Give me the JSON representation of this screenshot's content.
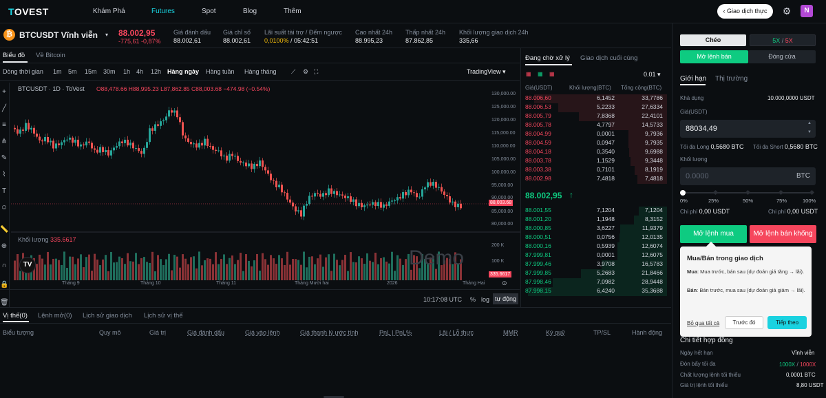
{
  "nav": {
    "logo_t": "T",
    "logo_rest": "OVEST",
    "items": [
      "Khám Phá",
      "Futures",
      "Spot",
      "Blog",
      "Thêm"
    ],
    "trade_button": "Giao dịch thực",
    "avatar": "N"
  },
  "ticker": {
    "symbol": "BTCUSDT Vĩnh viễn",
    "price": "88.002,95",
    "change": "-775,61",
    "change_pct": "-0,87%",
    "stats": [
      {
        "label": "Giá đánh dấu",
        "value": "88.002,61"
      },
      {
        "label": "Giá chỉ số",
        "value": "88.002,61"
      },
      {
        "label": "Lãi suất tài trợ / Đếm ngược",
        "value": "0,0100%",
        "value2": "/ 05:42:51"
      },
      {
        "label": "Cao nhất 24h",
        "value": "88.995,23"
      },
      {
        "label": "Thấp nhất 24h",
        "value": "87.862,85"
      },
      {
        "label": "Khối lượng giao dịch 24h",
        "value": "335,66"
      }
    ]
  },
  "chart_tabs": [
    "Biểu đồ",
    "Về Bitcoin"
  ],
  "timeframes": [
    "Dòng thời gian",
    "1m",
    "5m",
    "15m",
    "30m",
    "1h",
    "4h",
    "12h",
    "Hàng ngày",
    "Hàng tuần",
    "Hàng tháng"
  ],
  "tradingview": "TradingView",
  "chart_header": "BTCUSDT · 1D · ToVest",
  "ohlc": "O88,478.66 H88,995.23 L87,862.85 C88,003.68 −474.98 (−0.54%)",
  "volume_label": "Khối lượng",
  "volume_value": "335.6617",
  "watermark": "Demo",
  "price_ticks": [
    "130,000.00",
    "125,000.00",
    "120,000.00",
    "115,000.00",
    "110,000.00",
    "105,000.00",
    "100,000.00",
    "95,000.00",
    "90,000.00",
    "85,000.00",
    "80,000.00"
  ],
  "price_tag": "88,003.68",
  "vol_ticks": [
    "200 K",
    "100 K"
  ],
  "vol_tag": "335.6617",
  "x_ticks": [
    "Tháng 9",
    "Tháng 10",
    "Tháng 11",
    "Tháng Mười hai",
    "2026",
    "Tháng Hai"
  ],
  "chart_footer": {
    "time": "10:17:08 UTC",
    "pct": "%",
    "log": "log",
    "auto": "tự động"
  },
  "orderbook": {
    "tabs": [
      "Đang chờ xử lý",
      "Giao dịch cuối cùng"
    ],
    "tick": "0.01",
    "headers": [
      "Giá(USDT)",
      "Khối lượng(BTC)",
      "Tổng cộng(BTC)"
    ],
    "asks": [
      [
        "88.006,60",
        "6,1452",
        "33,7786"
      ],
      [
        "88.006,53",
        "5,2233",
        "27,6334"
      ],
      [
        "88.005,79",
        "7,8368",
        "22,4101"
      ],
      [
        "88.005,78",
        "4,7797",
        "14,5733"
      ],
      [
        "88.004,99",
        "0,0001",
        "9,7936"
      ],
      [
        "88.004,59",
        "0,0947",
        "9,7935"
      ],
      [
        "88.004,18",
        "0,3540",
        "9,6988"
      ],
      [
        "88.003,78",
        "1,1529",
        "9,3448"
      ],
      [
        "88.003,38",
        "0,7101",
        "8,1919"
      ],
      [
        "88.002,98",
        "7,4818",
        "7,4818"
      ]
    ],
    "mid": "88.002,95",
    "bids": [
      [
        "88.001,55",
        "7,1204",
        "7,1204"
      ],
      [
        "88.001,20",
        "1,1948",
        "8,3152"
      ],
      [
        "88.000,85",
        "3,6227",
        "11,9379"
      ],
      [
        "88.000,51",
        "0,0756",
        "12,0135"
      ],
      [
        "88.000,16",
        "0,5939",
        "12,6074"
      ],
      [
        "87.999,81",
        "0,0001",
        "12,6075"
      ],
      [
        "87.999,46",
        "3,9708",
        "16,5783"
      ],
      [
        "87.999,85",
        "5,2683",
        "21,8466"
      ],
      [
        "87.998,46",
        "7,0982",
        "28,9448"
      ],
      [
        "87.998,15",
        "6,4240",
        "35,3688"
      ]
    ]
  },
  "bottom_tabs": [
    "Vị thế(0)",
    "Lệnh mở(0)",
    "Lịch sử giao dịch",
    "Lịch sử vị thế"
  ],
  "bottom_headers": [
    "Biểu tượng",
    "Quy mô",
    "Giá trị",
    "Giá đánh dấu",
    "Giá vào lệnh",
    "Giá thanh lý ước tính",
    "PnL | PnL%",
    "Lãi / Lỗ thực",
    "MMR",
    "Ký quỹ",
    "TP/SL",
    "Hành động"
  ],
  "form": {
    "margin": "Chéo",
    "lev1": "5X",
    "lev2": "5X",
    "open_tab": "Mở lệnh bán",
    "close_tab": "Đóng cửa",
    "limit": "Giới hạn",
    "market": "Thị trường",
    "avail_label": "Khả dụng",
    "avail": "10.000,0000 USDT",
    "price_label": "Giá(USDT)",
    "price": "88034,49",
    "max_long_label": "Tối đa Long",
    "max_long": "0,5680 BTC",
    "max_short_label": "Tối đa Short",
    "max_short": "0,5680 BTC",
    "qty_label": "Khối lượng",
    "qty_placeholder": "0.0000",
    "qty_unit": "BTC",
    "pcts": [
      "0%",
      "25%",
      "50%",
      "75%",
      "100%"
    ],
    "cost_label": "Chi phí",
    "cost": "0,00 USDT",
    "cost2": "0,00 USDT",
    "buy": "Mở lệnh mua",
    "sell": "Mở lệnh bán khống"
  },
  "tooltip": {
    "title": "Mua/Bán trong giao dịch",
    "buy_b": "Mua",
    "buy_t": ": Mua trước, bán sau (dự đoán giá tăng → lãi).",
    "sell_b": "Bán",
    "sell_t": ": Bán trước, mua sau (dự đoán giá giảm → lãi).",
    "skip": "Bỏ qua tất cả",
    "prev": "Trước đó",
    "next": "Tiếp theo"
  },
  "contract": {
    "title": "Chi tiết hợp đồng",
    "rows": [
      [
        "Ngày hết hạn",
        "Vĩnh viễn"
      ],
      [
        "Đòn bẩy tối đa",
        "1000X",
        "1000X"
      ],
      [
        "Chất lượng lệnh tối thiểu",
        "0,0001 BTC"
      ],
      [
        "Giá trị lệnh tối thiểu",
        "8,80 USDT"
      ]
    ]
  },
  "chart_data": {
    "type": "candlestick",
    "ylim": [
      78000,
      132000
    ]
  },
  "colors": {
    "accent": "#0ecb81",
    "down": "#f6465d",
    "up": "#26a69a"
  }
}
